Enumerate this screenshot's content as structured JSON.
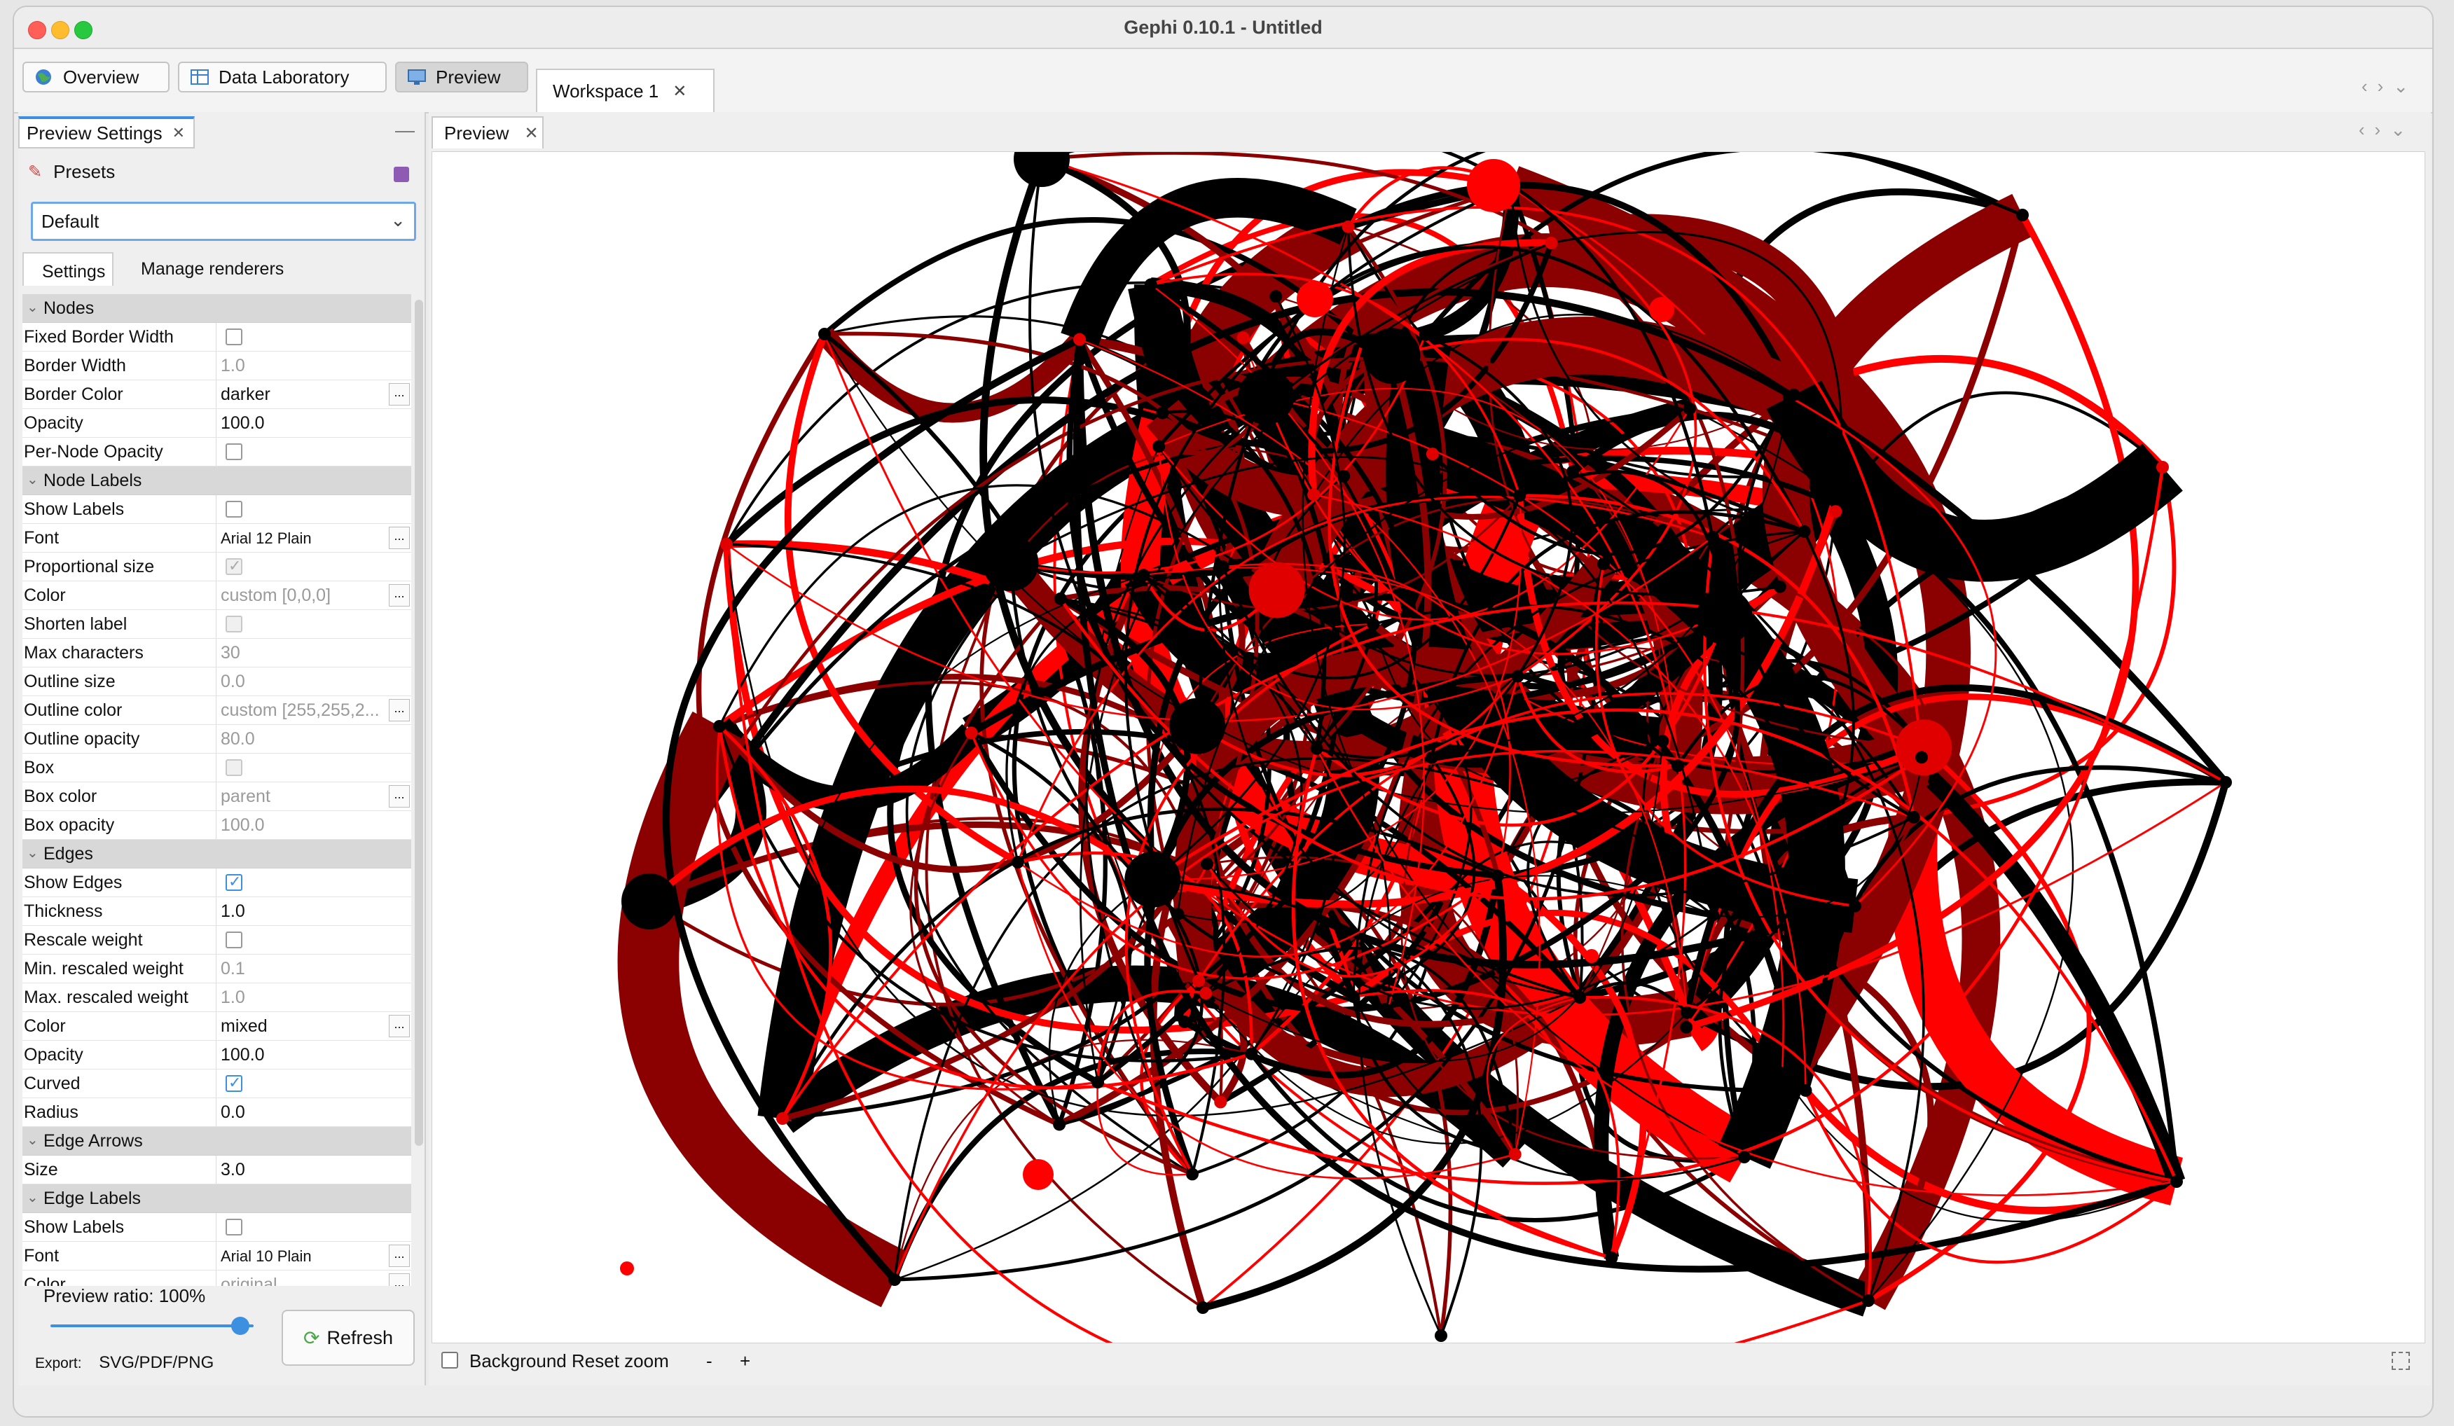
{
  "window": {
    "title": "Gephi 0.10.1 - Untitled"
  },
  "toolbar": {
    "overview": "Overview",
    "data_lab": "Data Laboratory",
    "preview": "Preview",
    "workspace_tab": "Workspace 1"
  },
  "left_panel": {
    "tab_label": "Preview Settings",
    "presets_label": "Presets",
    "preset_value": "Default",
    "subtab_settings": "Settings",
    "subtab_renderers": "Manage renderers",
    "sections": [
      {
        "title": "Nodes",
        "rows": [
          {
            "name": "Fixed Border Width",
            "type": "checkbox",
            "checked": false,
            "enabled": true
          },
          {
            "name": "Border Width",
            "type": "text",
            "value": "1.0",
            "enabled": false
          },
          {
            "name": "Border Color",
            "type": "text",
            "value": "darker",
            "enabled": true,
            "dots": true
          },
          {
            "name": "Opacity",
            "type": "text",
            "value": "100.0",
            "enabled": true
          },
          {
            "name": "Per-Node Opacity",
            "type": "checkbox",
            "checked": false,
            "enabled": true
          }
        ]
      },
      {
        "title": "Node Labels",
        "rows": [
          {
            "name": "Show Labels",
            "type": "checkbox",
            "checked": false,
            "enabled": true
          },
          {
            "name": "Font",
            "type": "text",
            "value": "Arial 12 Plain",
            "enabled": true,
            "dots": true,
            "small": true
          },
          {
            "name": "Proportional size",
            "type": "checkbox",
            "checked": true,
            "enabled": false
          },
          {
            "name": "Color",
            "type": "text",
            "value": "custom [0,0,0]",
            "enabled": false,
            "dots": true
          },
          {
            "name": "Shorten label",
            "type": "checkbox",
            "checked": false,
            "enabled": false
          },
          {
            "name": "Max characters",
            "type": "text",
            "value": "30",
            "enabled": false
          },
          {
            "name": "Outline size",
            "type": "text",
            "value": "0.0",
            "enabled": false
          },
          {
            "name": "Outline color",
            "type": "text",
            "value": "custom [255,255,2...",
            "enabled": false,
            "dots": true
          },
          {
            "name": "Outline opacity",
            "type": "text",
            "value": "80.0",
            "enabled": false
          },
          {
            "name": "Box",
            "type": "checkbox",
            "checked": false,
            "enabled": false
          },
          {
            "name": "Box color",
            "type": "text",
            "value": "parent",
            "enabled": false,
            "dots": true
          },
          {
            "name": "Box opacity",
            "type": "text",
            "value": "100.0",
            "enabled": false
          }
        ]
      },
      {
        "title": "Edges",
        "rows": [
          {
            "name": "Show Edges",
            "type": "checkbox",
            "checked": true,
            "enabled": true
          },
          {
            "name": "Thickness",
            "type": "text",
            "value": "1.0",
            "enabled": true
          },
          {
            "name": "Rescale weight",
            "type": "checkbox",
            "checked": false,
            "enabled": true
          },
          {
            "name": "Min. rescaled weight",
            "type": "text",
            "value": "0.1",
            "enabled": false
          },
          {
            "name": "Max. rescaled weight",
            "type": "text",
            "value": "1.0",
            "enabled": false
          },
          {
            "name": "Color",
            "type": "text",
            "value": "mixed",
            "enabled": true,
            "dots": true
          },
          {
            "name": "Opacity",
            "type": "text",
            "value": "100.0",
            "enabled": true
          },
          {
            "name": "Curved",
            "type": "checkbox",
            "checked": true,
            "enabled": true
          },
          {
            "name": "Radius",
            "type": "text",
            "value": "0.0",
            "enabled": true
          }
        ]
      },
      {
        "title": "Edge Arrows",
        "rows": [
          {
            "name": "Size",
            "type": "text",
            "value": "3.0",
            "enabled": true
          }
        ]
      },
      {
        "title": "Edge Labels",
        "rows": [
          {
            "name": "Show Labels",
            "type": "checkbox",
            "checked": false,
            "enabled": true
          },
          {
            "name": "Font",
            "type": "text",
            "value": "Arial 10 Plain",
            "enabled": true,
            "dots": true,
            "small": true
          },
          {
            "name": "Color",
            "type": "text",
            "value": "original",
            "enabled": false,
            "dots": true
          }
        ]
      }
    ],
    "preview_ratio": "Preview ratio: 100%",
    "ratio_value": 1.0,
    "refresh": "Refresh",
    "export_label": "Export:",
    "export_value": "SVG/PDF/PNG"
  },
  "right_panel": {
    "tab_label": "Preview",
    "background_label": "Background",
    "reset_zoom": "Reset zoom",
    "zoom_out": "-",
    "zoom_in": "+"
  },
  "colors": {
    "accent": "#3d8fe0",
    "edge_red": "#ff0000",
    "edge_dark_red": "#8b0000",
    "edge_black": "#000000"
  }
}
